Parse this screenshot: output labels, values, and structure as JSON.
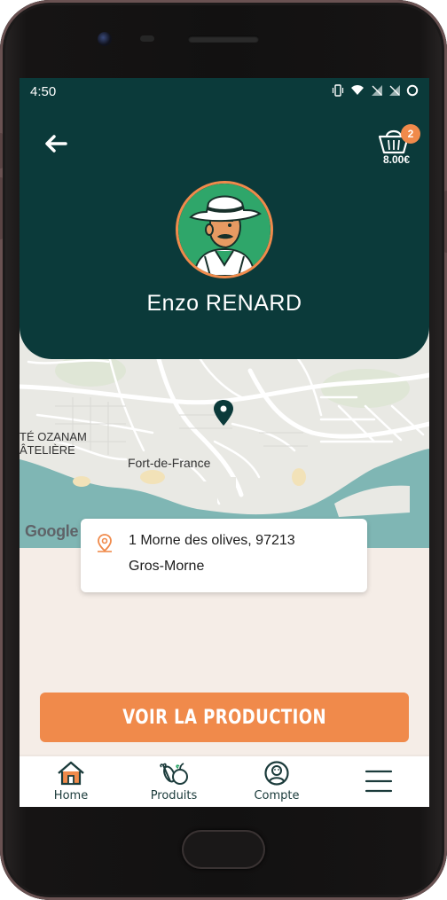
{
  "status_bar": {
    "time": "4:50"
  },
  "header": {
    "cart": {
      "badge_count": "2",
      "total": "8.00€"
    },
    "producer_name": "Enzo RENARD"
  },
  "map": {
    "labels": {
      "city": "Fort-de-France",
      "district_1": "TÉ OZANAM",
      "district_2": "ÂTELIÈRE"
    },
    "attribution": "Google"
  },
  "address": {
    "line1": "1 Morne des olives, 97213",
    "line2": "Gros-Morne"
  },
  "cta": {
    "label": "VOIR LA PRODUCTION"
  },
  "nav": {
    "items": [
      {
        "label": "Home",
        "icon": "house-icon"
      },
      {
        "label": "Produits",
        "icon": "produce-icon"
      },
      {
        "label": "Compte",
        "icon": "user-circle-icon"
      },
      {
        "label": "",
        "icon": "hamburger-menu-icon"
      }
    ]
  },
  "colors": {
    "header_bg": "#0b3a3a",
    "accent": "#f08a4b",
    "screen_bg": "#f5ede7",
    "sea": "#7fb6b4"
  }
}
